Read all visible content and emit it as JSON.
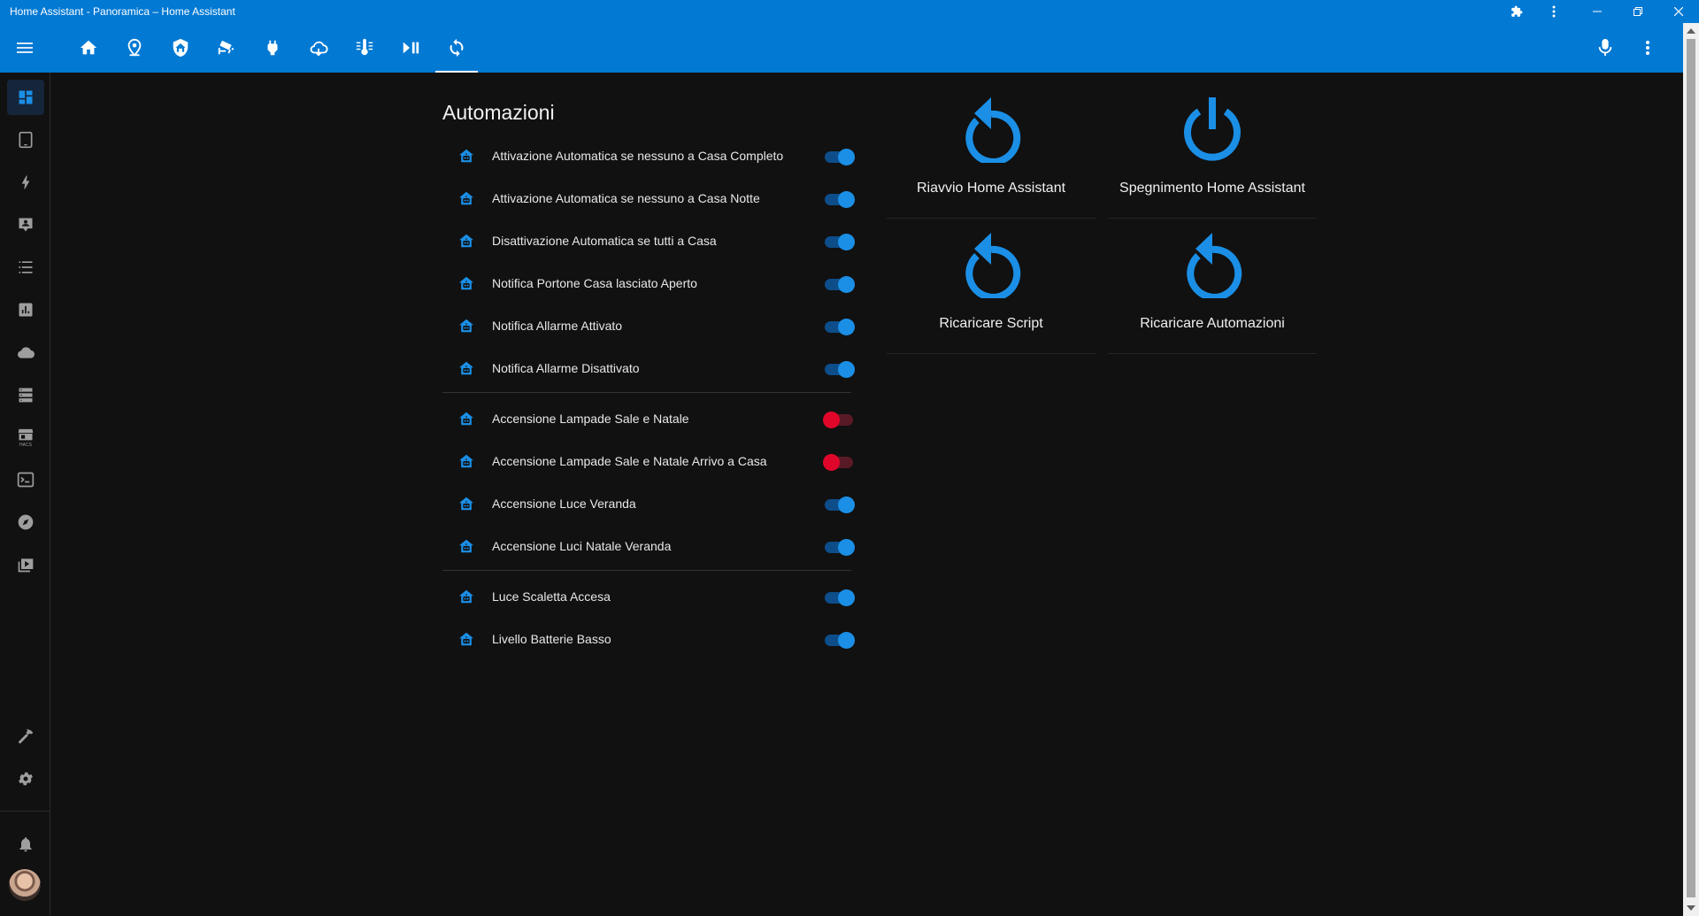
{
  "window": {
    "title": "Home Assistant - Panoramica – Home Assistant",
    "icons": [
      "extension-icon",
      "more-vert-icon",
      "minimize-icon",
      "restore-icon",
      "close-icon"
    ]
  },
  "toolbar": {
    "tabs": [
      {
        "icon": "home-icon"
      },
      {
        "icon": "map-marker-icon"
      },
      {
        "icon": "shield-home-icon"
      },
      {
        "icon": "cctv-icon"
      },
      {
        "icon": "power-plug-icon"
      },
      {
        "icon": "weather-cloud-icon"
      },
      {
        "icon": "thermometer-icon"
      },
      {
        "icon": "play-pause-icon"
      },
      {
        "icon": "refresh-icon",
        "active": true
      }
    ],
    "right_icons": [
      "microphone-icon",
      "more-vert-icon"
    ]
  },
  "sidebar": {
    "items": [
      {
        "icon": "dashboard-icon",
        "selected": true
      },
      {
        "icon": "tablet-icon"
      },
      {
        "icon": "lightning-icon"
      },
      {
        "icon": "account-box-icon"
      },
      {
        "icon": "format-list-icon"
      },
      {
        "icon": "chart-box-icon"
      },
      {
        "icon": "cloud-icon"
      },
      {
        "icon": "server-icon"
      },
      {
        "icon": "hacs-icon",
        "text": "HACS"
      },
      {
        "icon": "console-icon"
      },
      {
        "icon": "compass-icon"
      },
      {
        "icon": "play-box-icon"
      }
    ],
    "bottom": [
      {
        "icon": "hammer-icon"
      },
      {
        "icon": "cog-icon"
      },
      {
        "icon": "bell-icon"
      }
    ]
  },
  "automations": {
    "title": "Automazioni",
    "groups": [
      [
        {
          "label": "Attivazione Automatica se nessuno a Casa Completo",
          "on": true
        },
        {
          "label": "Attivazione Automatica se nessuno a Casa Notte",
          "on": true
        },
        {
          "label": "Disattivazione Automatica se tutti a Casa",
          "on": true
        },
        {
          "label": "Notifica Portone Casa lasciato Aperto",
          "on": true
        },
        {
          "label": "Notifica Allarme Attivato",
          "on": true
        },
        {
          "label": "Notifica Allarme Disattivato",
          "on": true
        }
      ],
      [
        {
          "label": "Accensione Lampade Sale e Natale",
          "on": false
        },
        {
          "label": "Accensione Lampade Sale e Natale Arrivo a Casa",
          "on": false
        },
        {
          "label": "Accensione Luce Veranda",
          "on": true
        },
        {
          "label": "Accensione Luci Natale Veranda",
          "on": true
        }
      ],
      [
        {
          "label": "Luce Scaletta Accesa",
          "on": true
        },
        {
          "label": "Livello Batterie Basso",
          "on": true
        }
      ]
    ]
  },
  "buttons": [
    {
      "label": "Riavvio Home Assistant",
      "icon": "restart-icon"
    },
    {
      "label": "Spegnimento Home Assistant",
      "icon": "power-icon"
    },
    {
      "label": "Ricaricare Script",
      "icon": "restart-icon"
    },
    {
      "label": "Ricaricare Automazioni",
      "icon": "restart-icon"
    }
  ],
  "colors": {
    "primary": "#0279d3",
    "icon_blue": "#1b8fe6",
    "off_red": "#e0062a",
    "background": "#111111"
  }
}
